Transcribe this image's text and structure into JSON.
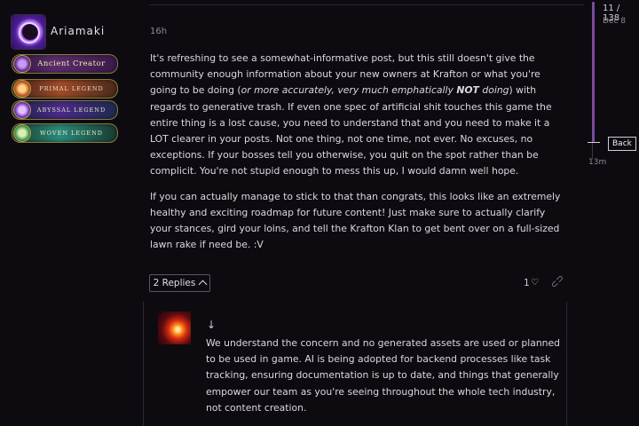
{
  "post": {
    "username": "Ariamaki",
    "time": "16h",
    "badges": [
      "Ancient Creator",
      "Primal Legend",
      "Abyssal Legend",
      "Woven Legend"
    ],
    "p1_a": "It's refreshing to see a somewhat-informative post, but this still doesn't give the community enough information about your new owners at Krafton or what you're going to be doing (",
    "p1_em": "or more accurately, very much emphatically ",
    "p1_strong": "NOT",
    "p1_em2": " doing",
    "p1_b": ") with regards to generative trash. If even one spec of artificial shit touches this game the entire thing is a lost cause, you need to understand that and you need to make it a LOT clearer in your posts. Not one thing, not one time, not ever. No excuses, no exceptions. If your bosses tell you otherwise, you quit on the spot rather than be complicit. You're not stupid enough to mess this up, I would damn well hope.",
    "p2": "If you can actually manage to stick to that than congrats, this looks like an extremely healthy and exciting roadmap for future content! Just make sure to actually clarify your stances, gird your loins, and tell the Krafton Klan to get bent over on a full-sized lawn rake if need be. :V",
    "replies_label": "2 Replies",
    "likes": "1"
  },
  "reply": {
    "text": "We understand the concern and no generated assets are used or planned to be used in game. AI is being adopted for backend processes like task tracking, ensuring documentation is up to date, and things that generally empower our team as you're seeing throughout the whole tech industry, not content creation."
  },
  "timeline": {
    "counter": "11 / 138",
    "date": "Dec 8",
    "back_label": "Back",
    "bottom_label": "13m",
    "progress_fraction": 0.08
  },
  "icons": {
    "heart": "heart-icon",
    "link": "link-icon",
    "arrow": "arrow-down-icon"
  }
}
